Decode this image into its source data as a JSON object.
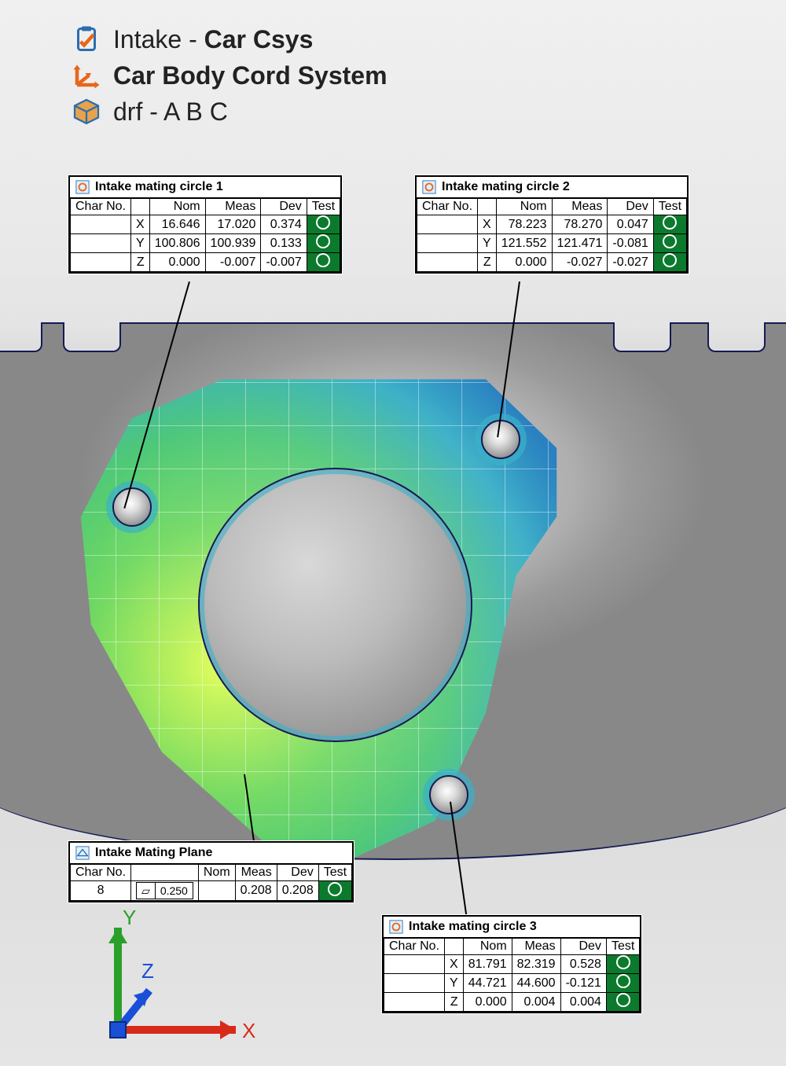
{
  "header": {
    "row1_plain": "Intake - ",
    "row1_bold": "Car Csys",
    "row2_bold": "Car Body Cord System",
    "row3_plain_prefix": "drf - ",
    "row3_plain_rest": "A B C"
  },
  "columns": {
    "char_no": "Char No.",
    "nom": "Nom",
    "meas": "Meas",
    "dev": "Dev",
    "test": "Test"
  },
  "axis_labels": {
    "X": "X",
    "Y": "Y",
    "Z": "Z"
  },
  "callouts": {
    "c1": {
      "title": "Intake mating circle 1",
      "rows": [
        {
          "axis": "X",
          "nom": "16.646",
          "meas": "17.020",
          "dev": "0.374"
        },
        {
          "axis": "Y",
          "nom": "100.806",
          "meas": "100.939",
          "dev": "0.133"
        },
        {
          "axis": "Z",
          "nom": "0.000",
          "meas": "-0.007",
          "dev": "-0.007"
        }
      ]
    },
    "c2": {
      "title": "Intake mating circle 2",
      "rows": [
        {
          "axis": "X",
          "nom": "78.223",
          "meas": "78.270",
          "dev": "0.047"
        },
        {
          "axis": "Y",
          "nom": "121.552",
          "meas": "121.471",
          "dev": "-0.081"
        },
        {
          "axis": "Z",
          "nom": "0.000",
          "meas": "-0.027",
          "dev": "-0.027"
        }
      ]
    },
    "c3": {
      "title": "Intake mating circle 3",
      "rows": [
        {
          "axis": "X",
          "nom": "81.791",
          "meas": "82.319",
          "dev": "0.528"
        },
        {
          "axis": "Y",
          "nom": "44.721",
          "meas": "44.600",
          "dev": "-0.121"
        },
        {
          "axis": "Z",
          "nom": "0.000",
          "meas": "0.004",
          "dev": "0.004"
        }
      ]
    },
    "plane": {
      "title": "Intake Mating Plane",
      "char_no": "8",
      "tolerance_symbol": "⏥",
      "tolerance_value": "0.250",
      "nom": "",
      "meas": "0.208",
      "dev": "0.208"
    }
  },
  "triad": {
    "x": "X",
    "y": "Y",
    "z": "Z"
  },
  "colors": {
    "pass": "#0b7a2d",
    "accent": "#e8661b",
    "outline": "#151a55"
  }
}
